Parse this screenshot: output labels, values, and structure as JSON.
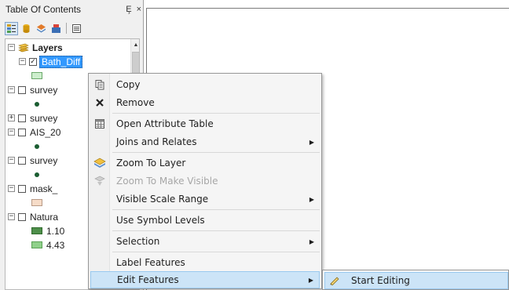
{
  "toc": {
    "title": "Table Of Contents",
    "pin_glyph": "Ȩ",
    "close_glyph": "×",
    "toolbar": [
      "list-by-drawing-order-icon",
      "list-by-source-icon",
      "list-by-visibility-icon",
      "list-by-selection-icon",
      "options-icon"
    ],
    "layers_label": "Layers",
    "rows": [
      {
        "name": "Bath_Diff",
        "checked": true,
        "expanded": true,
        "selected": true
      },
      {
        "name": "survey",
        "checked": false,
        "expanded": true
      },
      {
        "name": "survey",
        "checked": false,
        "expanded": false
      },
      {
        "name": "AIS_20",
        "checked": false,
        "expanded": true
      },
      {
        "name": "survey",
        "checked": false,
        "expanded": true
      },
      {
        "name": "mask_",
        "checked": false,
        "expanded": true
      },
      {
        "name": "Natura",
        "checked": false,
        "expanded": true
      }
    ],
    "legend_values": [
      "1.10",
      "4.43"
    ],
    "check_glyph": "✓",
    "expanded_glyph": "−",
    "collapsed_glyph": "+"
  },
  "context_menu": {
    "items": [
      {
        "label": "Copy",
        "icon": "copy-icon"
      },
      {
        "label": "Remove",
        "icon": "remove-icon"
      },
      {
        "label": "Open Attribute Table",
        "icon": "attribute-table-icon"
      },
      {
        "label": "Joins and Relates",
        "icon": "",
        "submenu": true
      },
      {
        "label": "Zoom To Layer",
        "icon": "zoom-to-layer-icon"
      },
      {
        "label": "Zoom To Make Visible",
        "icon": "zoom-to-make-visible-icon",
        "disabled": true
      },
      {
        "label": "Visible Scale Range",
        "icon": "",
        "submenu": true
      },
      {
        "label": "Use Symbol Levels",
        "icon": ""
      },
      {
        "label": "Selection",
        "icon": "",
        "submenu": true
      },
      {
        "label": "Label Features",
        "icon": ""
      },
      {
        "label": "Edit Features",
        "icon": "",
        "submenu": true,
        "highlighted": true
      }
    ],
    "submenu_arrow": "▶"
  },
  "submenu": {
    "items": [
      {
        "label": "Start Editing",
        "icon": "pencil-icon",
        "highlighted": true
      }
    ]
  },
  "colors": {
    "selection": "#3399ff",
    "menu_highlight": "#cce4f7",
    "point_symbol": "#1b5d32",
    "raster_low": "#4e8f4a",
    "raster_high": "#8fd08a",
    "bath_swatch": "#cdeecd",
    "mask_swatch": "#f6dcc8"
  }
}
